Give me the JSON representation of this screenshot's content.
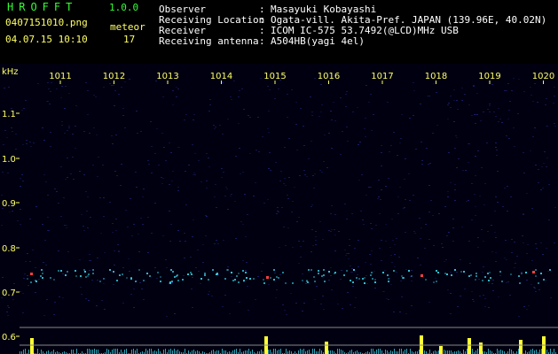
{
  "app": {
    "title": "HROFFT",
    "version": "1.0.0"
  },
  "file": {
    "name": "0407151010.png",
    "datetime": "04.07.15 10:10"
  },
  "meteor": {
    "label": "meteor",
    "count": "17"
  },
  "info": {
    "observer_label": "Observer",
    "observer_value": "Masayuki Kobayashi",
    "location_label": "Receiving Location",
    "location_value": "Ogata-vill. Akita-Pref. JAPAN (139.96E, 40.02N)",
    "receiver_label": "Receiver",
    "receiver_value": "ICOM IC-575 53.7492(@LCD)MHz USB",
    "antenna_label": "Receiving antenna",
    "antenna_value": "A504HB(yagi 4el)"
  },
  "spectrogram": {
    "y_unit": "kHz",
    "y_ticks": [
      "1.1",
      "1.0",
      "0.9",
      "0.8",
      "0.7",
      "0.6"
    ],
    "x_ticks": [
      "1011",
      "1012",
      "1013",
      "1014",
      "1015",
      "1016",
      "1017",
      "1018",
      "1019",
      "1020"
    ],
    "colors": {
      "background": "#000010",
      "noise": "#1c1c6a",
      "tick_text": "#ffff66",
      "baseline": "#888888",
      "signal_band": "#35c7e0",
      "signal_hot": "#ff4040",
      "meter_cyan": "#33ccdd",
      "meter_yellow": "#ffff33"
    }
  }
}
